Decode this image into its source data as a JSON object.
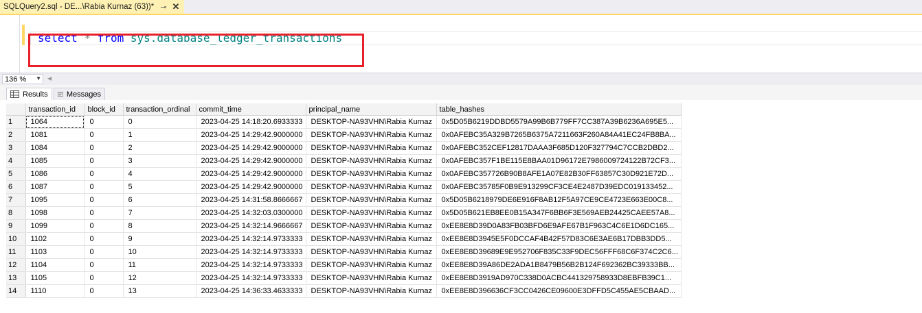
{
  "tab": {
    "title": "SQLQuery2.sql - DE...\\Rabia Kurnaz (63))*",
    "pin": "⊸",
    "close": "✕"
  },
  "editor": {
    "kw_select": "select",
    "star": "*",
    "kw_from": "from",
    "object": "sys.database_ledger_transactions"
  },
  "zoom": {
    "value": "136 %"
  },
  "results_tabs": [
    {
      "label": "Results"
    },
    {
      "label": "Messages"
    }
  ],
  "colors": {
    "keyword": "#0000ff",
    "identifier": "#008080",
    "highlight_box": "#e8202a",
    "tab_active": "#fff1b3"
  },
  "grid": {
    "columns": [
      "",
      "transaction_id",
      "block_id",
      "transaction_ordinal",
      "commit_time",
      "principal_name",
      "table_hashes"
    ],
    "rows": [
      [
        "1",
        "1064",
        "0",
        "0",
        "2023-04-25 14:18:20.6933333",
        "DESKTOP-NA93VHN\\Rabia Kurnaz",
        "0x5D05B6219DDBD5579A99B6B779FF7CC387A39B6236A695E5..."
      ],
      [
        "2",
        "1081",
        "0",
        "1",
        "2023-04-25 14:29:42.9000000",
        "DESKTOP-NA93VHN\\Rabia Kurnaz",
        "0x0AFEBC35A329B7265B6375A7211663F260A84A41EC24FB8BA..."
      ],
      [
        "3",
        "1084",
        "0",
        "2",
        "2023-04-25 14:29:42.9000000",
        "DESKTOP-NA93VHN\\Rabia Kurnaz",
        "0x0AFEBC352CEF12817DAAA3F685D120F327794C7CCB2DBD2..."
      ],
      [
        "4",
        "1085",
        "0",
        "3",
        "2023-04-25 14:29:42.9000000",
        "DESKTOP-NA93VHN\\Rabia Kurnaz",
        "0x0AFEBC357F1BE115E8BAA01D96172E7986009724122B72CF3..."
      ],
      [
        "5",
        "1086",
        "0",
        "4",
        "2023-04-25 14:29:42.9000000",
        "DESKTOP-NA93VHN\\Rabia Kurnaz",
        "0x0AFEBC357726B90B8AFE1A07E82B30FF63857C30D921E72D..."
      ],
      [
        "6",
        "1087",
        "0",
        "5",
        "2023-04-25 14:29:42.9000000",
        "DESKTOP-NA93VHN\\Rabia Kurnaz",
        "0x0AFEBC35785F0B9E913299CF3CE4E2487D39EDC019133452..."
      ],
      [
        "7",
        "1095",
        "0",
        "6",
        "2023-04-25 14:31:58.8666667",
        "DESKTOP-NA93VHN\\Rabia Kurnaz",
        "0x5D05B6218979DE6E916F8AB12F5A97CE9CE4723E663E00C8..."
      ],
      [
        "8",
        "1098",
        "0",
        "7",
        "2023-04-25 14:32:03.0300000",
        "DESKTOP-NA93VHN\\Rabia Kurnaz",
        "0x5D05B621EB8EE0B15A347F6BB6F3E569AEB24425CAEE57A8..."
      ],
      [
        "9",
        "1099",
        "0",
        "8",
        "2023-04-25 14:32:14.9666667",
        "DESKTOP-NA93VHN\\Rabia Kurnaz",
        "0xEE8E8D39D0A83FB03BFD6E9AFE67B1F963C4C6E1D6DC165..."
      ],
      [
        "10",
        "1102",
        "0",
        "9",
        "2023-04-25 14:32:14.9733333",
        "DESKTOP-NA93VHN\\Rabia Kurnaz",
        "0xEE8E8D3945E5F0DCCAF4B42F57D83C6E3AE6B17DBB3DD5..."
      ],
      [
        "11",
        "1103",
        "0",
        "10",
        "2023-04-25 14:32:14.9733333",
        "DESKTOP-NA93VHN\\Rabia Kurnaz",
        "0xEE8E8D39689E9E952706F835C33F9DEC56FFF68C6F374C2C6..."
      ],
      [
        "12",
        "1104",
        "0",
        "11",
        "2023-04-25 14:32:14.9733333",
        "DESKTOP-NA93VHN\\Rabia Kurnaz",
        "0xEE8E8D39A86DE2ADA1B8479B56B2B124F692362BC39333BB..."
      ],
      [
        "13",
        "1105",
        "0",
        "12",
        "2023-04-25 14:32:14.9733333",
        "DESKTOP-NA93VHN\\Rabia Kurnaz",
        "0xEE8E8D3919AD970C338D0ACBC441329758933D8EBFB39C1..."
      ],
      [
        "14",
        "1110",
        "0",
        "13",
        "2023-04-25 14:36:33.4633333",
        "DESKTOP-NA93VHN\\Rabia Kurnaz",
        "0xEE8E8D396636CF3CC0426CE09600E3DFFD5C455AE5CBAAD..."
      ]
    ]
  }
}
